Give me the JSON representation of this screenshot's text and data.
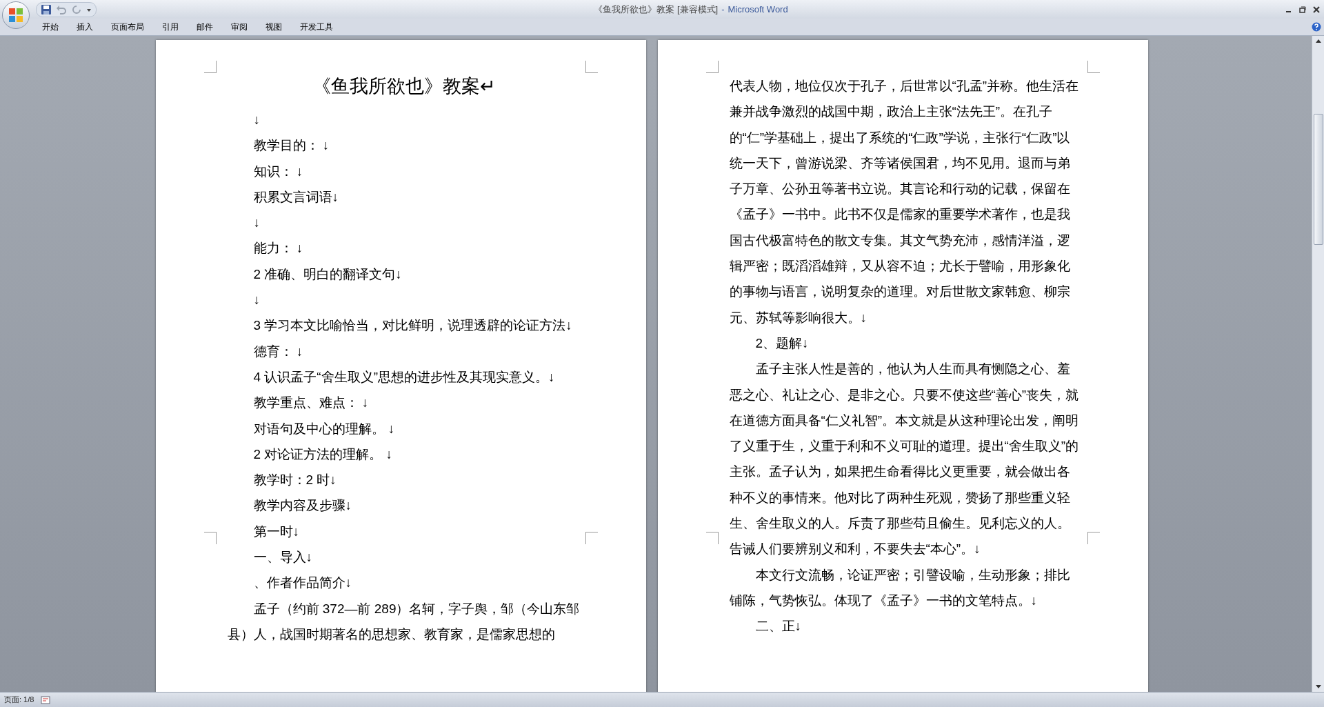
{
  "window": {
    "title": "《鱼我所欲也》教案 [兼容模式]",
    "separator": "-",
    "app": "Microsoft Word"
  },
  "tabs": [
    {
      "label": "开始",
      "selected": false
    },
    {
      "label": "插入",
      "selected": false
    },
    {
      "label": "页面布局",
      "selected": false
    },
    {
      "label": "引用",
      "selected": false
    },
    {
      "label": "邮件",
      "selected": false
    },
    {
      "label": "审阅",
      "selected": false
    },
    {
      "label": "视图",
      "selected": false
    },
    {
      "label": "开发工具",
      "selected": false
    }
  ],
  "pages": [
    {
      "paragraphs": [
        {
          "kind": "title",
          "text": "《鱼我所欲也》教案↵"
        },
        {
          "kind": "indent",
          "text": "↓"
        },
        {
          "kind": "indent",
          "text": "教学目的： ↓"
        },
        {
          "kind": "indent",
          "text": "知识： ↓"
        },
        {
          "kind": "indent",
          "text": "积累文言词语↓"
        },
        {
          "kind": "indent",
          "text": "↓"
        },
        {
          "kind": "indent",
          "text": "能力： ↓"
        },
        {
          "kind": "indent",
          "text": "2 准确、明白的翻译文句↓"
        },
        {
          "kind": "indent",
          "text": "↓"
        },
        {
          "kind": "indent",
          "text": "3 学习本文比喻恰当，对比鲜明，说理透辟的论证方法↓"
        },
        {
          "kind": "indent",
          "text": "德育： ↓"
        },
        {
          "kind": "indent",
          "text": "4 认识孟子“舍生取义”思想的进步性及其现实意义。↓"
        },
        {
          "kind": "indent",
          "text": "教学重点、难点： ↓"
        },
        {
          "kind": "indent",
          "text": "对语句及中心的理解。 ↓"
        },
        {
          "kind": "indent",
          "text": "2 对论证方法的理解。 ↓"
        },
        {
          "kind": "indent",
          "text": "教学时：2 时↓"
        },
        {
          "kind": "indent",
          "text": "教学内容及步骤↓"
        },
        {
          "kind": "indent",
          "text": "第一时↓"
        },
        {
          "kind": "indent",
          "text": "一、导入↓"
        },
        {
          "kind": "indent",
          "text": "、作者作品简介↓"
        },
        {
          "kind": "indent",
          "text": "孟子（约前 372—前 289）名轲，字子舆，邹（今山东邹县）人，战国时期著名的思想家、教育家，是儒家思想的"
        }
      ]
    },
    {
      "paragraphs": [
        {
          "kind": "flush",
          "text": "代表人物，地位仅次于孔子，后世常以“孔孟”并称。他生活在兼并战争激烈的战国中期，政治上主张“法先王”。在孔子的“仁”学基础上，提出了系统的“仁政”学说，主张行“仁政”以统一天下，曾游说梁、齐等诸侯国君，均不见用。退而与弟子万章、公孙丑等著书立说。其言论和行动的记载，保留在《孟子》一书中。此书不仅是儒家的重要学术著作，也是我国古代极富特色的散文专集。其文气势充沛，感情洋溢，逻辑严密；既滔滔雄辩，又从容不迫；尤长于譬喻，用形象化的事物与语言，说明复杂的道理。对后世散文家韩愈、柳宗元、苏轼等影响很大。↓"
        },
        {
          "kind": "indent",
          "text": "2、题解↓"
        },
        {
          "kind": "indent",
          "text": "孟子主张人性是善的，他认为人生而具有恻隐之心、羞恶之心、礼让之心、是非之心。只要不使这些“善心”丧失，就在道德方面具备“仁义礼智”。本文就是从这种理论出发，阐明了义重于生，义重于利和不义可耻的道理。提出“舍生取义”的主张。孟子认为，如果把生命看得比义更重要，就会做出各种不义的事情来。他对比了两种生死观，赞扬了那些重义轻生、舍生取义的人。斥责了那些苟且偷生。见利忘义的人。告诫人们要辨别义和利，不要失去“本心”。↓"
        },
        {
          "kind": "indent",
          "text": "本文行文流畅，论证严密；引譬设喻，生动形象；排比铺陈，气势恢弘。体现了《孟子》一书的文笔特点。↓"
        },
        {
          "kind": "indent",
          "text": "二、正↓"
        }
      ]
    }
  ],
  "status_bar": {
    "page": "页面: 1/8"
  }
}
